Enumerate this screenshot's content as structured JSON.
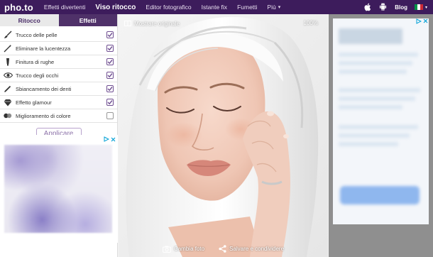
{
  "nav": {
    "logo": "pho.to",
    "items": [
      {
        "label": "Effetti divertenti"
      },
      {
        "label": "Viso ritocco"
      },
      {
        "label": "Editor fotografico"
      },
      {
        "label": "Istante fix"
      },
      {
        "label": "Fumetti"
      },
      {
        "label": "Più"
      }
    ],
    "more_caret": "▾",
    "blog": "Blog",
    "flag_caret": "▾"
  },
  "tabs": {
    "ritocco": "Ritocco",
    "effetti": "Effetti"
  },
  "tools": [
    {
      "label": "Trucco delle pelle",
      "checked": true,
      "icon": "brush-icon"
    },
    {
      "label": "Eliminare la lucentezza",
      "checked": true,
      "icon": "wand-icon"
    },
    {
      "label": "Finitura di rughe",
      "checked": true,
      "icon": "tube-icon"
    },
    {
      "label": "Trucco degli occhi",
      "checked": true,
      "icon": "eye-icon"
    },
    {
      "label": "Sbiancamento dei denti",
      "checked": true,
      "icon": "pen-icon"
    },
    {
      "label": "Effetto glamour",
      "checked": true,
      "icon": "diamond-icon"
    },
    {
      "label": "Miglioramento di colore",
      "checked": false,
      "icon": "color-circles-icon"
    }
  ],
  "apply_button": "Applicare",
  "image_overlay": {
    "show_original": "Mostrare originale",
    "zoom": "100%",
    "change_photo": "Cambia foto",
    "save_share": "Salvare e condividere"
  },
  "colors": {
    "nav_bg": "#3d1c5c",
    "accent": "#6f4e91"
  }
}
